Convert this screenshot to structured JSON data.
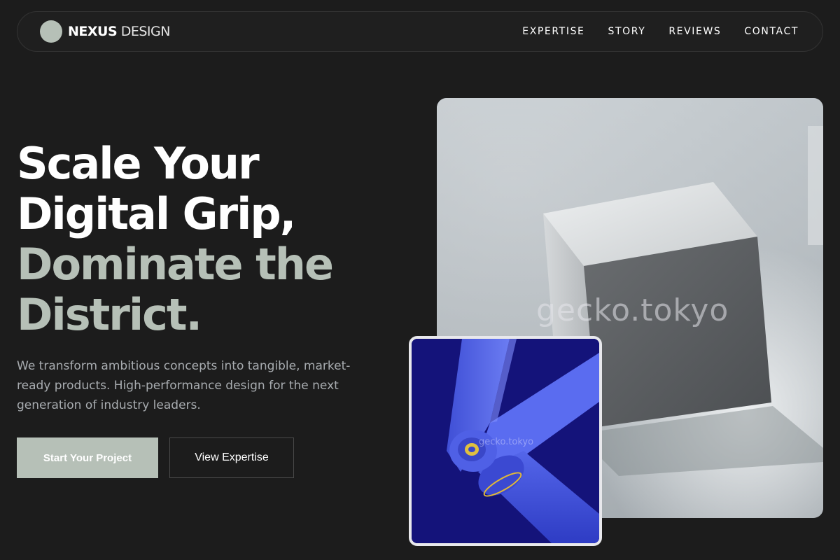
{
  "brand": {
    "name_strong": "NEXUS",
    "name_light": "DESIGN"
  },
  "nav": {
    "links": [
      {
        "label": "EXPERTISE"
      },
      {
        "label": "STORY"
      },
      {
        "label": "REVIEWS"
      },
      {
        "label": "CONTACT"
      }
    ]
  },
  "hero": {
    "title_lines": [
      "Scale Your",
      "Digital Grip,",
      "Dominate the",
      "District."
    ],
    "description": "We transform ambitious concepts into tangible, market-ready products. High-performance design for the next generation of industry leaders.",
    "primary_cta": "Start Your Project",
    "secondary_cta": "View Expertise"
  },
  "images": {
    "main_watermark": "gecko.tokyo",
    "sub_watermark": "gecko.tokyo"
  },
  "colors": {
    "background": "#1c1c1c",
    "accent_sage": "#b6c0b7",
    "sub_image_bg": "#15157a",
    "arm_blue": "#4a5ce0"
  }
}
